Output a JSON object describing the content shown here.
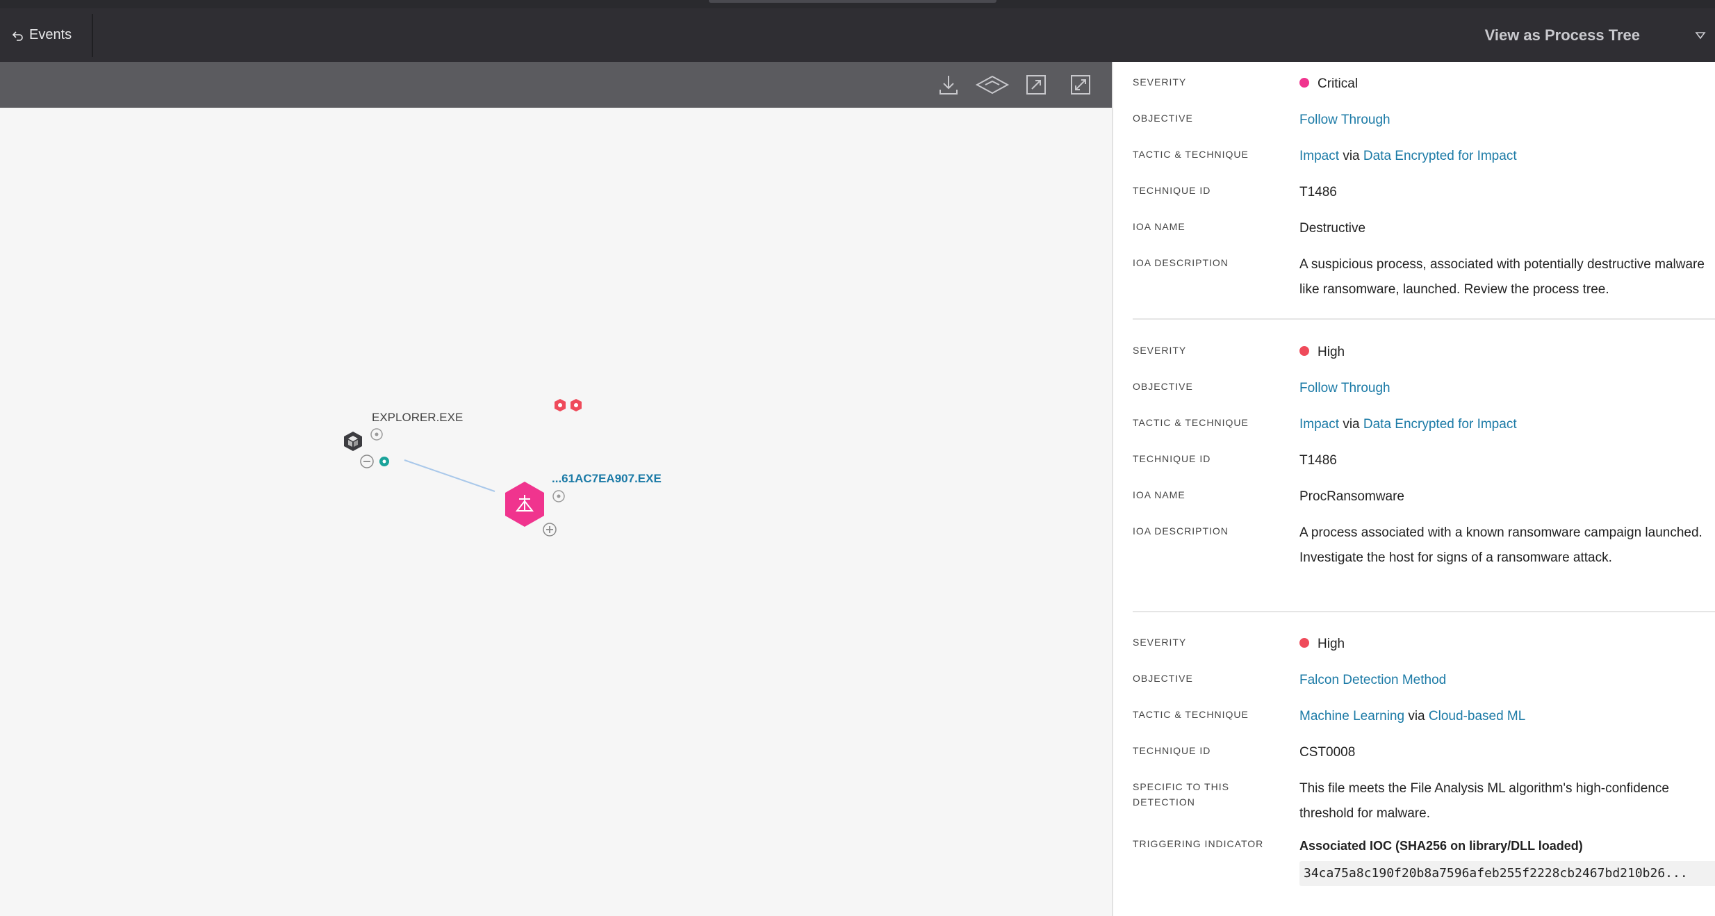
{
  "header": {
    "back_label": "Events",
    "view_label": "View as Process Tree"
  },
  "toolbar": {
    "icons": [
      "download-icon",
      "layers-icon",
      "expand-icon",
      "fit-icon"
    ]
  },
  "graph": {
    "parent_process": "EXPLORER.EXE",
    "child_process": "...61AC7EA907.EXE",
    "edge_color": "#a9c8ea",
    "child_color": "#f0348e"
  },
  "detections": [
    {
      "severity_label": "SEVERITY",
      "severity": "Critical",
      "severity_color": "#f0348e",
      "objective_label": "OBJECTIVE",
      "objective": "Follow Through",
      "tactic_label": "TACTIC & TECHNIQUE",
      "tactic": "Impact",
      "via": "via",
      "technique": "Data Encrypted for Impact",
      "technique_id_label": "TECHNIQUE ID",
      "technique_id": "T1486",
      "ioa_name_label": "IOA NAME",
      "ioa_name": "Destructive",
      "ioa_desc_label": "IOA DESCRIPTION",
      "ioa_desc": "A suspicious process, associated with potentially destructive malware like ransomware, launched. Review the process tree."
    },
    {
      "severity_label": "SEVERITY",
      "severity": "High",
      "severity_color": "#ef4a5a",
      "objective_label": "OBJECTIVE",
      "objective": "Follow Through",
      "tactic_label": "TACTIC & TECHNIQUE",
      "tactic": "Impact",
      "via": "via",
      "technique": "Data Encrypted for Impact",
      "technique_id_label": "TECHNIQUE ID",
      "technique_id": "T1486",
      "ioa_name_label": "IOA NAME",
      "ioa_name": "ProcRansomware",
      "ioa_desc_label": "IOA DESCRIPTION",
      "ioa_desc": "A process associated with a known ransomware campaign launched. Investigate the host for signs of a ransomware attack."
    },
    {
      "severity_label": "SEVERITY",
      "severity": "High",
      "severity_color": "#ef4a5a",
      "objective_label": "OBJECTIVE",
      "objective": "Falcon Detection Method",
      "tactic_label": "TACTIC & TECHNIQUE",
      "tactic": "Machine Learning",
      "via": "via",
      "technique": "Cloud-based ML",
      "technique_id_label": "TECHNIQUE ID",
      "technique_id": "CST0008",
      "specific_label": "SPECIFIC TO THIS DETECTION",
      "specific": "This file meets the File Analysis ML algorithm's high-confidence threshold for malware.",
      "triggering_label": "TRIGGERING INDICATOR",
      "triggering_title": "Associated IOC (SHA256 on library/DLL loaded)",
      "triggering_hash": "34ca75a8c190f20b8a7596afeb255f2228cb2467bd210b26..."
    }
  ]
}
